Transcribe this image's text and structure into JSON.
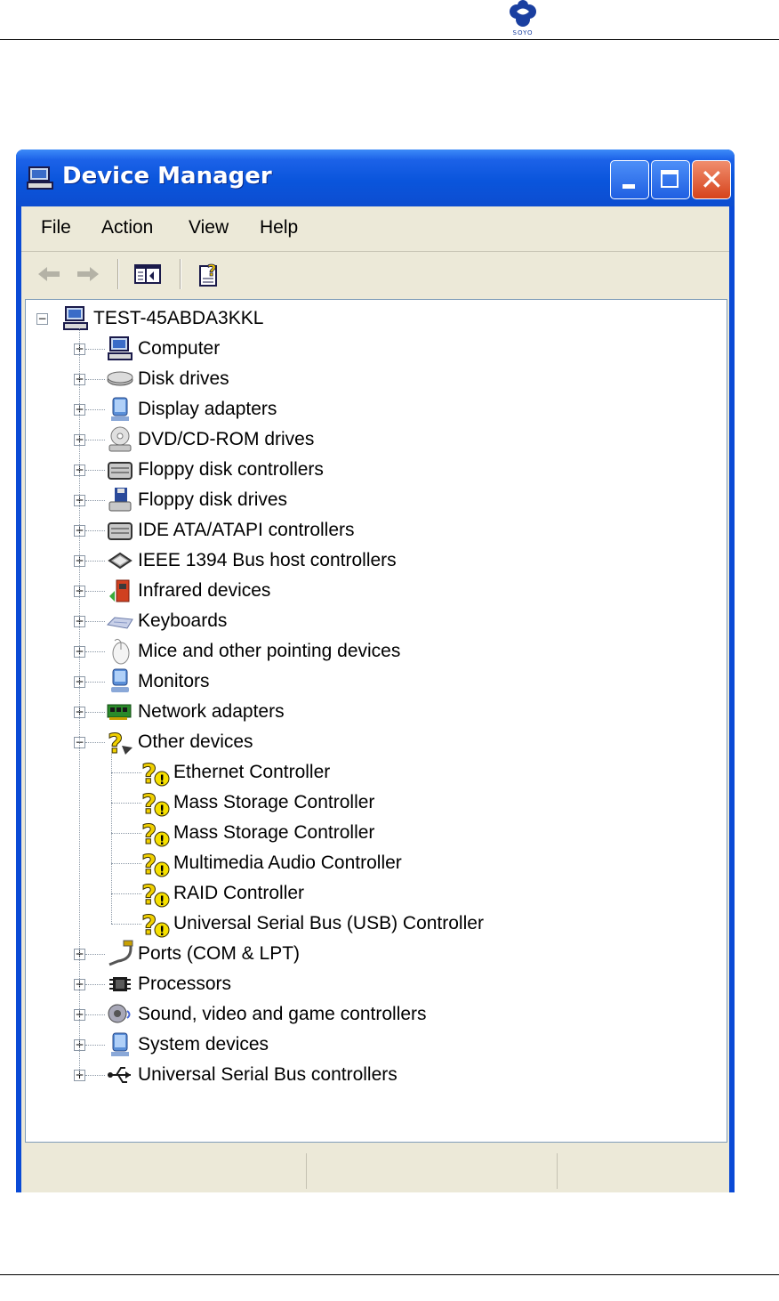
{
  "brand": {
    "text": "SOYO",
    "color": "#1a3fa0"
  },
  "window": {
    "title": "Device Manager",
    "accent": "#0a4ad6",
    "controls": [
      "minimize-icon",
      "maximize-icon",
      "close-icon"
    ]
  },
  "menu": {
    "items": [
      "File",
      "Action",
      "View",
      "Help"
    ]
  },
  "toolbar": {
    "buttons": [
      "back-arrow-icon",
      "forward-arrow-icon",
      "show-hide-console-tree-icon",
      "help-icon"
    ]
  },
  "tree": {
    "root": {
      "label": "TEST-45ABDA3KKL",
      "icon": "computer-icon",
      "expanded": true
    },
    "categories": [
      {
        "label": "Computer",
        "icon": "computer-icon",
        "expanded": false
      },
      {
        "label": "Disk drives",
        "icon": "disk-drive-icon",
        "expanded": false
      },
      {
        "label": "Display adapters",
        "icon": "display-adapter-icon",
        "expanded": false
      },
      {
        "label": "DVD/CD-ROM drives",
        "icon": "cd-rom-icon",
        "expanded": false
      },
      {
        "label": "Floppy disk controllers",
        "icon": "controller-icon",
        "expanded": false
      },
      {
        "label": "Floppy disk drives",
        "icon": "floppy-drive-icon",
        "expanded": false
      },
      {
        "label": "IDE ATA/ATAPI controllers",
        "icon": "controller-icon",
        "expanded": false
      },
      {
        "label": "IEEE 1394 Bus host controllers",
        "icon": "ieee1394-icon",
        "expanded": false
      },
      {
        "label": "Infrared devices",
        "icon": "infrared-icon",
        "expanded": false
      },
      {
        "label": "Keyboards",
        "icon": "keyboard-icon",
        "expanded": false
      },
      {
        "label": "Mice and other pointing devices",
        "icon": "mouse-icon",
        "expanded": false
      },
      {
        "label": "Monitors",
        "icon": "monitor-icon",
        "expanded": false
      },
      {
        "label": "Network adapters",
        "icon": "network-adapter-icon",
        "expanded": false
      },
      {
        "label": "Other devices",
        "icon": "unknown-device-icon",
        "expanded": true,
        "children": [
          {
            "label": "Ethernet Controller",
            "icon": "warning-device-icon"
          },
          {
            "label": "Mass Storage Controller",
            "icon": "warning-device-icon"
          },
          {
            "label": "Mass Storage Controller",
            "icon": "warning-device-icon"
          },
          {
            "label": "Multimedia Audio Controller",
            "icon": "warning-device-icon"
          },
          {
            "label": "RAID Controller",
            "icon": "warning-device-icon"
          },
          {
            "label": "Universal Serial Bus (USB) Controller",
            "icon": "warning-device-icon"
          }
        ]
      },
      {
        "label": "Ports (COM & LPT)",
        "icon": "port-icon",
        "expanded": false
      },
      {
        "label": "Processors",
        "icon": "processor-icon",
        "expanded": false
      },
      {
        "label": "Sound, video and game controllers",
        "icon": "sound-icon",
        "expanded": false
      },
      {
        "label": "System devices",
        "icon": "system-device-icon",
        "expanded": false
      },
      {
        "label": "Universal Serial Bus controllers",
        "icon": "usb-icon",
        "expanded": false
      }
    ]
  },
  "statusbar": {
    "cells": [
      "",
      "",
      ""
    ]
  }
}
